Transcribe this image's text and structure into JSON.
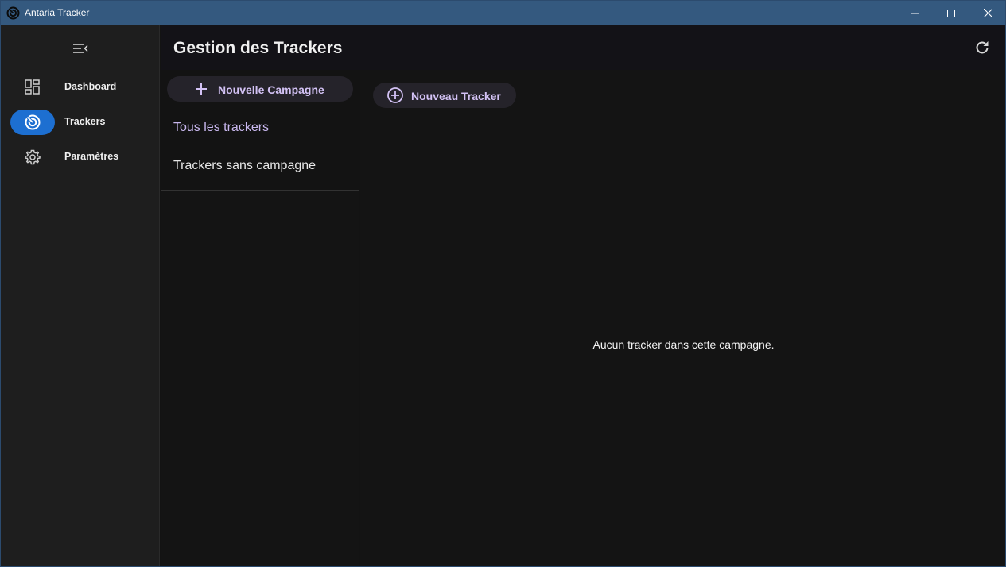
{
  "window": {
    "title": "Antaria Tracker",
    "controls": [
      "minimize",
      "maximize",
      "close"
    ]
  },
  "sidebar": {
    "toggle_icon": "menu-collapse-icon",
    "items": [
      {
        "label": "Dashboard",
        "icon": "dashboard-icon",
        "active": false
      },
      {
        "label": "Trackers",
        "icon": "tracker-target-icon",
        "active": true
      },
      {
        "label": "Paramètres",
        "icon": "gear-icon",
        "active": false
      }
    ]
  },
  "header": {
    "title": "Gestion des Trackers",
    "refresh_icon": "refresh-icon"
  },
  "campaigns": {
    "new_button": "Nouvelle Campagne",
    "links": [
      "Tous les trackers",
      "Trackers sans campagne"
    ]
  },
  "main": {
    "new_tracker_button": "Nouveau Tracker",
    "empty_message": "Aucun tracker dans cette campagne."
  },
  "colors": {
    "titlebar": "#34597f",
    "active_nav": "#1d6fd1",
    "accent_text": "#d3c2f5",
    "sidebar_bg": "#1e1e1e",
    "content_bg": "#141414"
  }
}
